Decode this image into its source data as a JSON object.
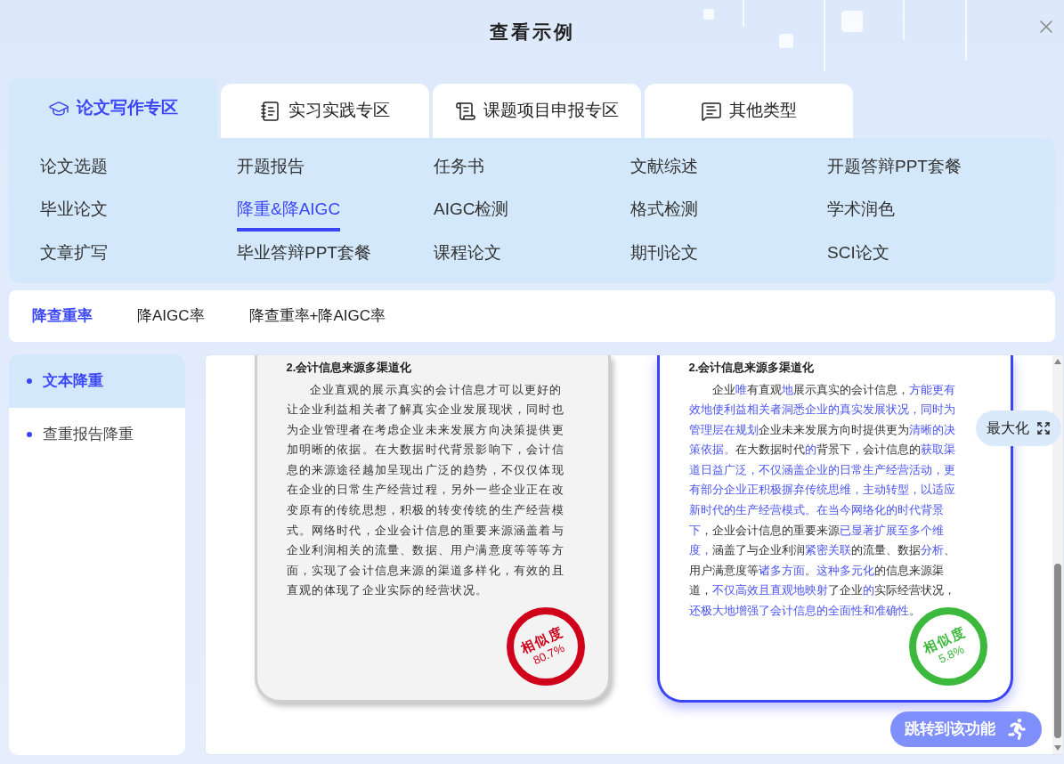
{
  "dialog": {
    "title": "查看示例"
  },
  "tabs": [
    {
      "label": "论文写作专区",
      "selected": true,
      "kind": "cap"
    },
    {
      "label": "实习实践专区",
      "selected": false,
      "kind": "notebook"
    },
    {
      "label": "课题项目申报专区",
      "selected": false,
      "kind": "document"
    },
    {
      "label": "其他类型",
      "selected": false,
      "kind": "message"
    }
  ],
  "categories": [
    {
      "label": "论文选题",
      "selected": false
    },
    {
      "label": "开题报告",
      "selected": false
    },
    {
      "label": "任务书",
      "selected": false
    },
    {
      "label": "文献综述",
      "selected": false
    },
    {
      "label": "开题答辩PPT套餐",
      "selected": false
    },
    {
      "label": "毕业论文",
      "selected": false
    },
    {
      "label": "降重&降AIGC",
      "selected": true
    },
    {
      "label": "AIGC检测",
      "selected": false
    },
    {
      "label": "格式检测",
      "selected": false
    },
    {
      "label": "学术润色",
      "selected": false
    },
    {
      "label": "文章扩写",
      "selected": false
    },
    {
      "label": "毕业答辩PPT套餐",
      "selected": false
    },
    {
      "label": "课程论文",
      "selected": false
    },
    {
      "label": "期刊论文",
      "selected": false
    },
    {
      "label": "SCI论文",
      "selected": false
    }
  ],
  "subtabs": [
    {
      "label": "降查重率",
      "selected": true
    },
    {
      "label": "降AIGC率",
      "selected": false
    },
    {
      "label": "降查重率+降AIGC率",
      "selected": false
    }
  ],
  "sidebar": {
    "items": [
      {
        "label": "文本降重",
        "selected": true
      },
      {
        "label": "查重报告降重",
        "selected": false
      }
    ]
  },
  "papers": [
    {
      "kind": "original",
      "title": "2.会计信息来源多渠道化",
      "segments": [
        {
          "text": "企业直观的展示真实的会计信息才可以更好的让企业利益相关者了解真实企业发展现状，同时也为企业管理者在考虑企业未来发展方向决策提供更加明晰的依据。在大数据时代背景影响下，会计信息的来源途径越加呈现出广泛的趋势，不仅仅体现在企业的日常生产经营过程，另外一些企业正在改变原有的传统思想，积极的转变传统的生产经营模式。网络时代，企业会计信息的重要来源涵盖着与企业利润相关的流量、数据、用户满意度等等等方面，实现了会计信息来源的渠道多样化，有效的且直观的体现了企业实际的经营状况。",
          "changed": false
        }
      ],
      "stamp": {
        "label": "相似度",
        "value": "80.7%",
        "color": "#d0021b"
      }
    },
    {
      "kind": "rewritten",
      "title": "2.会计信息来源多渠道化",
      "segments": [
        {
          "text": "企业",
          "changed": false
        },
        {
          "text": "唯",
          "changed": true
        },
        {
          "text": "有直观",
          "changed": false
        },
        {
          "text": "地",
          "changed": true
        },
        {
          "text": "展示真实的会计信息，",
          "changed": false
        },
        {
          "text": "方能更有效地使利益相关者洞悉企业的真实发展状况，同时为管理层在规划",
          "changed": true
        },
        {
          "text": "企业未来发展方向时提供更为",
          "changed": false
        },
        {
          "text": "清晰的决策依据。",
          "changed": true
        },
        {
          "text": "在大数据时代",
          "changed": false
        },
        {
          "text": "的",
          "changed": true
        },
        {
          "text": "背景下，会计信息的",
          "changed": false
        },
        {
          "text": "获取渠道日益广泛，不仅涵盖企业的日常生产经营活动，更有部分企业正积极摒弃传统思维，主动转型，以适应新时代的生产经营模式。在当今网络化的时代背景下",
          "changed": true
        },
        {
          "text": "，企业会计信息的重要来源",
          "changed": false
        },
        {
          "text": "已显著扩展至多个维度，",
          "changed": true
        },
        {
          "text": "涵盖了与企业利润",
          "changed": false
        },
        {
          "text": "紧密关联",
          "changed": true
        },
        {
          "text": "的流量、数据",
          "changed": false
        },
        {
          "text": "分析",
          "changed": true
        },
        {
          "text": "、用户满意度等",
          "changed": false
        },
        {
          "text": "诸多方面",
          "changed": true
        },
        {
          "text": "。",
          "changed": false
        },
        {
          "text": "这种多元化",
          "changed": true
        },
        {
          "text": "的信息来源渠道，",
          "changed": false
        },
        {
          "text": "不仅高效且直观地映射",
          "changed": true
        },
        {
          "text": "了企业",
          "changed": false
        },
        {
          "text": "的",
          "changed": true
        },
        {
          "text": "实际经营状况，",
          "changed": false
        },
        {
          "text": "还极大地增强了会计信息的全面性和准确性",
          "changed": true
        },
        {
          "text": "。",
          "changed": false
        }
      ],
      "stamp": {
        "label": "相似度",
        "value": "5.8%",
        "color": "#3cb93c"
      }
    }
  ],
  "maximize_button": {
    "label": "最大化"
  },
  "jump_button": {
    "label": "跳转到该功能"
  }
}
